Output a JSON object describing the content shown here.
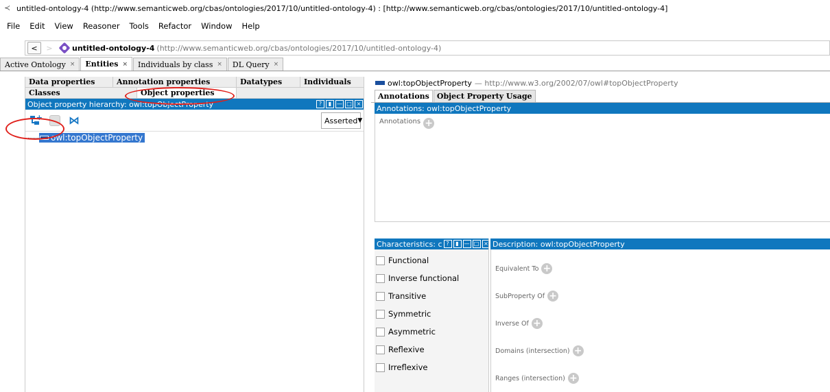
{
  "window": {
    "title": "untitled-ontology-4 (http://www.semanticweb.org/cbas/ontologies/2017/10/untitled-ontology-4) : [http://www.semanticweb.org/cbas/ontologies/2017/10/untitled-ontology-4]"
  },
  "menu": [
    "File",
    "Edit",
    "View",
    "Reasoner",
    "Tools",
    "Refactor",
    "Window",
    "Help"
  ],
  "address": {
    "back": "<",
    "forward": ">",
    "name": "untitled-ontology-4",
    "url": "(http://www.semanticweb.org/cbas/ontologies/2017/10/untitled-ontology-4)"
  },
  "tabs": [
    {
      "label": "Active Ontology",
      "close": "×"
    },
    {
      "label": "Entities",
      "close": "×"
    },
    {
      "label": "Individuals by class",
      "close": "×"
    },
    {
      "label": "DL Query",
      "close": "×"
    }
  ],
  "entity_tabs": {
    "row1": [
      "Data properties",
      "Annotation properties",
      "Datatypes",
      "Individuals"
    ],
    "row2": [
      "Classes",
      "Object properties"
    ]
  },
  "hierarchy": {
    "header": "Object property hierarchy: owl:topObjectProperty",
    "view_buttons": [
      "?",
      "▮",
      "—",
      "□",
      "×"
    ],
    "mode": "Asserted",
    "root": "owl:topObjectProperty"
  },
  "entity": {
    "name": "owl:topObjectProperty",
    "iri": "— http://www.w3.org/2002/07/owl#topObjectProperty"
  },
  "right_tabs": [
    "Annotations",
    "Object Property Usage"
  ],
  "annotations": {
    "header": "Annotations: owl:topObjectProperty",
    "label": "Annotations",
    "add": "+"
  },
  "characteristics": {
    "header": "Characteristics: c",
    "items": [
      "Functional",
      "Inverse functional",
      "Transitive",
      "Symmetric",
      "Asymmetric",
      "Reflexive",
      "Irreflexive"
    ]
  },
  "description": {
    "header": "Description: owl:topObjectProperty",
    "rows": [
      "Equivalent To",
      "SubProperty Of",
      "Inverse Of",
      "Domains (intersection)",
      "Ranges (intersection)"
    ]
  },
  "colors": {
    "header_blue": "#1077be",
    "selection_blue": "#3477cf",
    "annotation_red": "#e0201b"
  }
}
